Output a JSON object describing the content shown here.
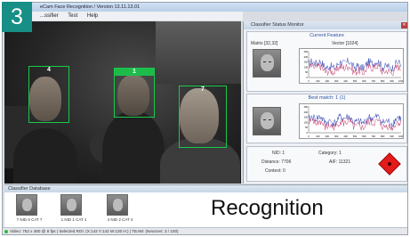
{
  "badge": "3",
  "window": {
    "title": "eCam Face Recognition / Version 13.11.13.01",
    "menu": [
      "...",
      "...ssifier",
      "Test",
      "Help"
    ]
  },
  "faces": [
    {
      "label": "4",
      "style": "clear"
    },
    {
      "label": "1",
      "style": "filled"
    },
    {
      "label": "7",
      "style": "clear"
    }
  ],
  "monitor": {
    "title": "Classifier Status Monitor",
    "current_feature": "Current Feature",
    "matrix_label": "Matrix [32,32]",
    "vector_label": "Vector [1024]",
    "best_match": "Best match: 1 (1)",
    "nid_label": "NID:",
    "nid_value": "1",
    "category_label": "Category:",
    "category_value": "1",
    "distance_label": "Distance:",
    "distance_value": "7706",
    "aif_label": "AIF:",
    "aif_value": "11321",
    "context_label": "Context:",
    "context_value": "0",
    "alert_color": "#e31b1b",
    "ticks": [
      "0",
      "100",
      "200",
      "300",
      "400",
      "500",
      "600",
      "700",
      "800",
      "900",
      "1000"
    ],
    "yticks_top": [
      "250",
      "200",
      "150",
      "100",
      "50",
      "0"
    ]
  },
  "database": {
    "title": "Classifier Database",
    "items": [
      {
        "caption": "7 NID 6 CAT 7"
      },
      {
        "caption": "1 NID 1 CAT 1"
      },
      {
        "caption": "4 NID 2 CAT 4"
      }
    ],
    "heading": "Recognition"
  },
  "statusbar": {
    "text": "Video: 752 x 480 @ 8 fps | Selected ROI: (X:143 Y:142 W:130 H:) | TEAM: (Neurons: 3 / 100)"
  }
}
